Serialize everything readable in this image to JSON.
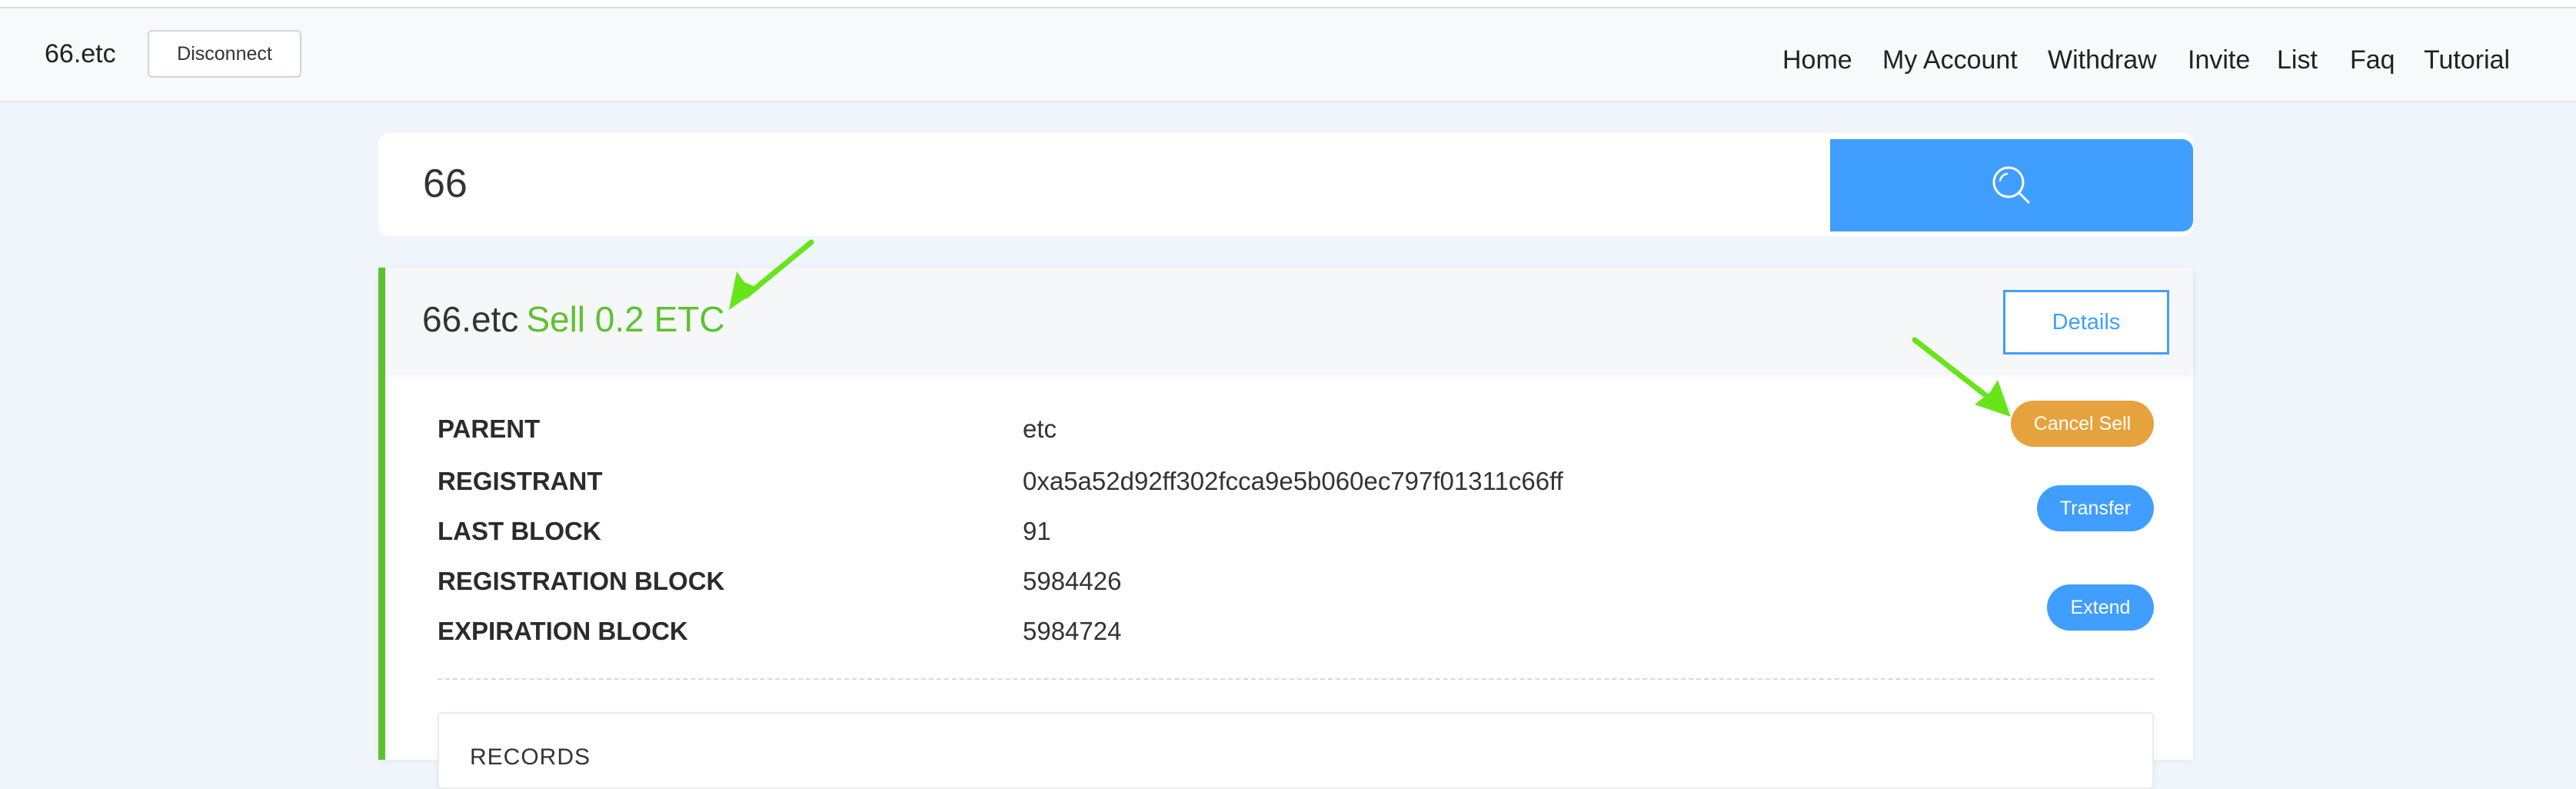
{
  "header": {
    "brand": "66.etc",
    "disconnect_label": "Disconnect",
    "nav": [
      "Home",
      "My Account",
      "Withdraw",
      "Invite",
      "List",
      "Faq",
      "Tutorial"
    ]
  },
  "search": {
    "value": "66",
    "button_icon": "search-icon"
  },
  "domain_card": {
    "name": "66.etc",
    "status": "Sell 0.2 ETC",
    "details_label": "Details",
    "fields": [
      {
        "label": "PARENT",
        "value": "etc"
      },
      {
        "label": "REGISTRANT",
        "value": "0xa5a52d92ff302fcca9e5b060ec797f01311c66ff"
      },
      {
        "label": "LAST BLOCK",
        "value": "91"
      },
      {
        "label": "REGISTRATION BLOCK",
        "value": "5984426"
      },
      {
        "label": "EXPIRATION BLOCK",
        "value": "5984724"
      }
    ],
    "actions": {
      "cancel_sell": "Cancel Sell",
      "transfer": "Transfer",
      "extend": "Extend"
    },
    "records_label": "RECORDS"
  },
  "colors": {
    "accent_blue": "#409eff",
    "sell_green": "#5cc32e",
    "cancel_orange": "#e6a23c",
    "arrow_green": "#66e619",
    "page_bg": "#f0f5fc"
  }
}
